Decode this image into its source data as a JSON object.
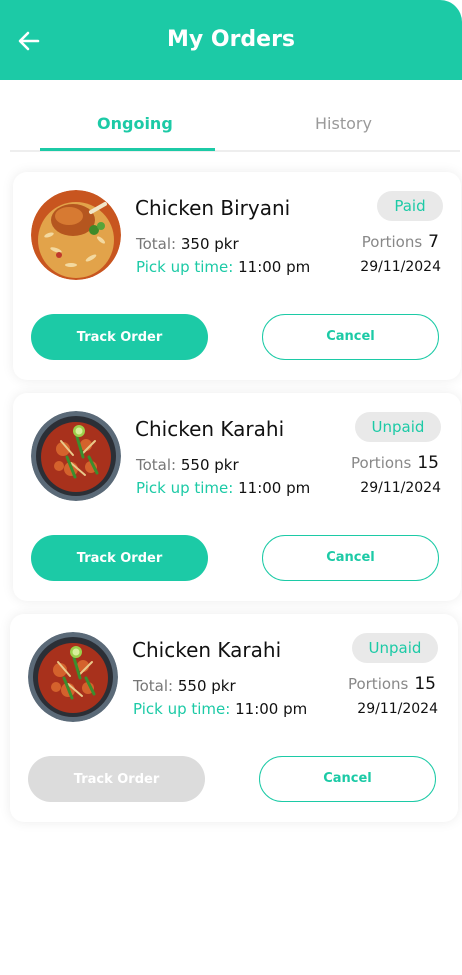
{
  "header": {
    "title": "My Orders",
    "back_icon": "arrow-left-icon",
    "color": "#1ccaa6"
  },
  "tabs": [
    {
      "label": "Ongoing",
      "active": true
    },
    {
      "label": "History",
      "active": false
    }
  ],
  "orders": [
    {
      "name": "Chicken Biryani",
      "image": "chicken-biryani-image",
      "status": "Paid",
      "total_label": "Total:",
      "total_value": "350 pkr",
      "pickup_label": "Pick up time:",
      "pickup_value": "11:00 pm",
      "portions_label": "Portions",
      "portions_value": "7",
      "date": "29/11/2024",
      "track_label": "Track Order",
      "track_enabled": true,
      "cancel_label": "Cancel"
    },
    {
      "name": "Chicken Karahi",
      "image": "chicken-karahi-image",
      "status": "Unpaid",
      "total_label": "Total:",
      "total_value": "550 pkr",
      "pickup_label": "Pick up time:",
      "pickup_value": "11:00 pm",
      "portions_label": "Portions",
      "portions_value": "15",
      "date": "29/11/2024",
      "track_label": "Track Order",
      "track_enabled": true,
      "cancel_label": "Cancel"
    },
    {
      "name": "Chicken Karahi",
      "image": "chicken-karahi-image",
      "status": "Unpaid",
      "total_label": "Total:",
      "total_value": "550 pkr",
      "pickup_label": "Pick up time:",
      "pickup_value": "11:00 pm",
      "portions_label": "Portions",
      "portions_value": "15",
      "date": "29/11/2024",
      "track_label": "Track Order",
      "track_enabled": false,
      "cancel_label": "Cancel"
    }
  ]
}
